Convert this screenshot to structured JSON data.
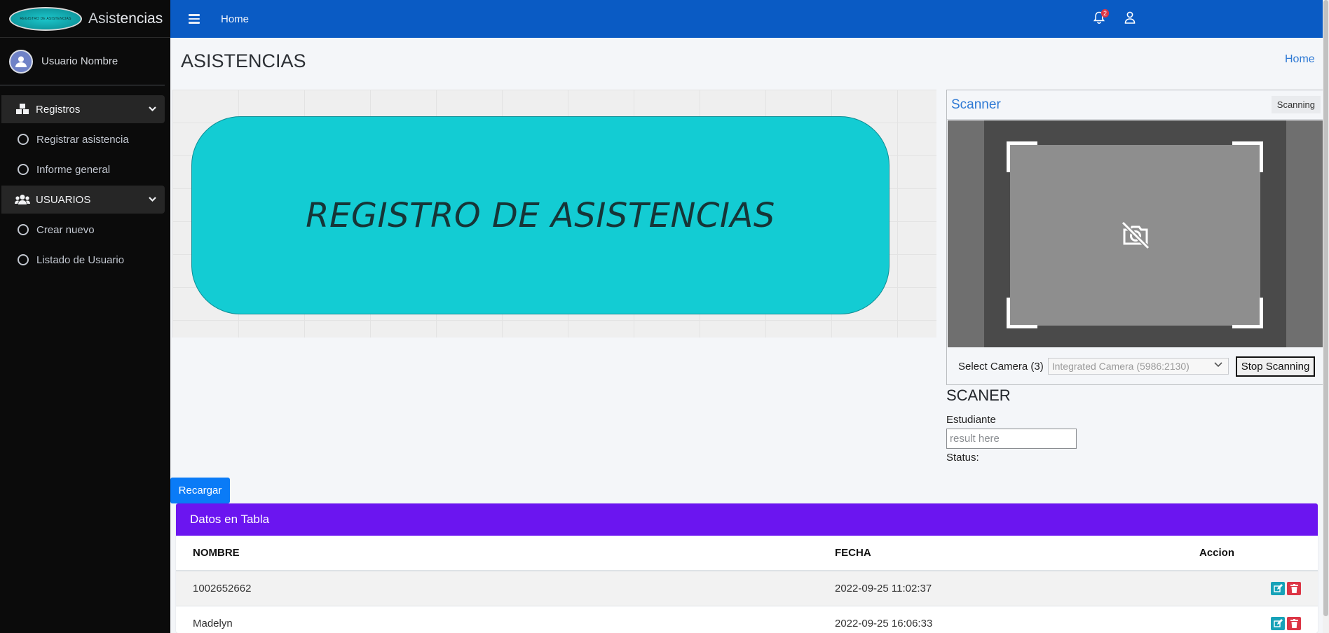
{
  "brand": {
    "logo_text": "REGISTRO DE ASISTENCIAS",
    "name_prefix": "Asis",
    "name_suffix": "tencias"
  },
  "user": {
    "name": "Usuario Nombre"
  },
  "sidebar": {
    "items": [
      {
        "label": "Registros",
        "type": "group",
        "icon": "cubes-icon"
      },
      {
        "label": "Registrar asistencia",
        "type": "link",
        "icon": "circle-icon"
      },
      {
        "label": "Informe general",
        "type": "link",
        "icon": "circle-icon"
      },
      {
        "label": "USUARIOS",
        "type": "group",
        "icon": "users-icon"
      },
      {
        "label": "Crear nuevo",
        "type": "link",
        "icon": "circle-icon"
      },
      {
        "label": "Listado de Usuario",
        "type": "link",
        "icon": "circle-icon"
      }
    ]
  },
  "header": {
    "home": "Home",
    "notifications_count": "2"
  },
  "page": {
    "title": "ASISTENCIAS",
    "breadcrumb": "Home"
  },
  "banner": {
    "text": "REGISTRO DE ASISTENCIAS"
  },
  "scanner": {
    "title": "Scanner",
    "status": "Scanning",
    "camera_label": "Select Camera (3)",
    "camera_selected": "Integrated Camera (5986:2130)",
    "stop_label": "Stop Scanning"
  },
  "scaner_form": {
    "title": "SCANER",
    "student_label": "Estudiante",
    "input_placeholder": "result here",
    "status_label": "Status:"
  },
  "reload_label": "Recargar",
  "table": {
    "title": "Datos en Tabla",
    "columns": [
      "NOMBRE",
      "FECHA",
      "Accion"
    ],
    "rows": [
      {
        "nombre": "1002652662",
        "fecha": "2022-09-25 11:02:37"
      },
      {
        "nombre": "Madelyn",
        "fecha": "2022-09-25 16:06:33"
      }
    ]
  },
  "colors": {
    "topbar": "#0a5bc4",
    "sidebar": "#0b0b0b",
    "banner": "#13ccd3",
    "table_header": "#6b15f0",
    "reload_button": "#0a7bf7"
  }
}
